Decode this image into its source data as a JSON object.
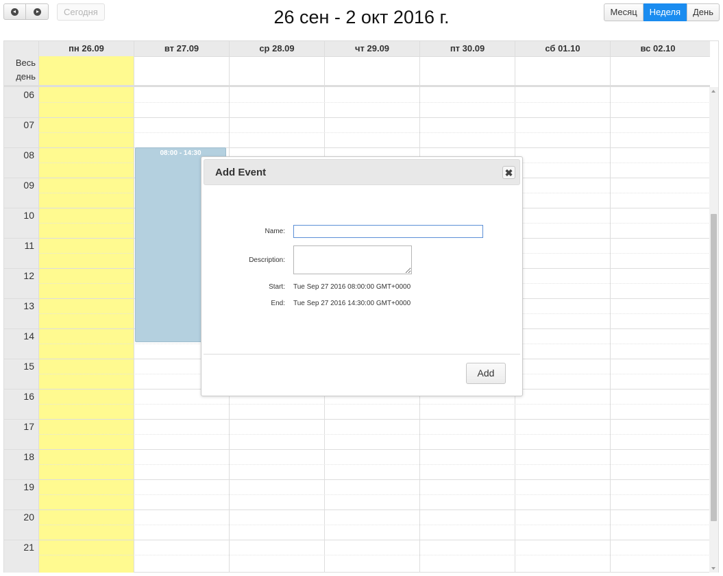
{
  "toolbar": {
    "prev_icon": "circle-arrow-left-icon",
    "next_icon": "circle-arrow-right-icon",
    "today_label": "Сегодня",
    "title": "26 сен - 2 окт 2016 г.",
    "views": [
      {
        "label": "Месяц",
        "active": false
      },
      {
        "label": "Неделя",
        "active": true
      },
      {
        "label": "День",
        "active": false
      }
    ]
  },
  "calendar": {
    "allday_label_line1": "Весь",
    "allday_label_line2": "день",
    "days": [
      "пн 26.09",
      "вт 27.09",
      "ср 28.09",
      "чт 29.09",
      "пт 30.09",
      "сб 01.10",
      "вс 02.10"
    ],
    "today_index": 0,
    "hours": [
      "06",
      "07",
      "08",
      "09",
      "10",
      "11",
      "12",
      "13",
      "14",
      "15",
      "16",
      "17",
      "18",
      "19",
      "20",
      "21"
    ],
    "event": {
      "time": "08:00 - 14:30",
      "color": "#b4d0df"
    }
  },
  "dialog": {
    "title": "Add Event",
    "close_icon": "close-x-icon",
    "name_label": "Name:",
    "name_value": "",
    "description_label": "Description:",
    "description_value": "",
    "start_label": "Start:",
    "start_value": "Tue Sep 27 2016 08:00:00 GMT+0000",
    "end_label": "End:",
    "end_value": "Tue Sep 27 2016 14:30:00 GMT+0000",
    "add_label": "Add"
  },
  "colors": {
    "accent": "#1a8cf0",
    "today_highlight": "#fffa90",
    "event": "#b4d0df"
  }
}
